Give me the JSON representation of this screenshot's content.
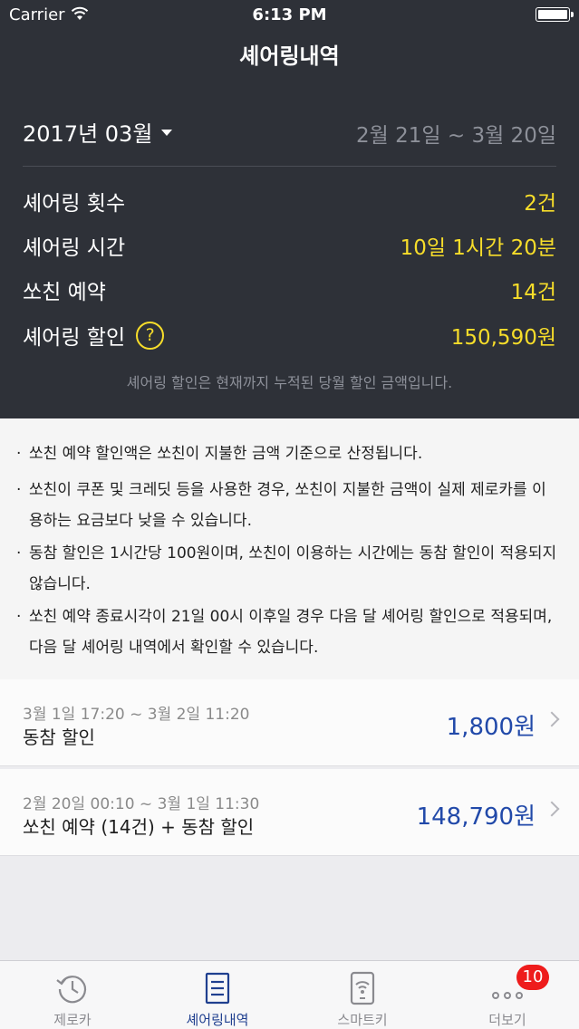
{
  "status_bar": {
    "carrier": "Carrier",
    "time": "6:13 PM"
  },
  "nav": {
    "title": "셰어링내역"
  },
  "period": {
    "month": "2017년 03월",
    "range": "2월 21일 ~ 3월 20일"
  },
  "stats": [
    {
      "label": "셰어링 횟수",
      "value": "2건"
    },
    {
      "label": "셰어링 시간",
      "value": "10일 1시간 20분"
    },
    {
      "label": "쏘친 예약",
      "value": "14건"
    },
    {
      "label": "셰어링 할인",
      "value": "150,590원",
      "help": "?"
    }
  ],
  "note": "셰어링 할인은 현재까지 누적된 당월 할인 금액입니다.",
  "info": [
    {
      "bullet": "·",
      "text": "쏘친 예약 할인액은 쏘친이 지불한 금액 기준으로 산정됩니다."
    },
    {
      "bullet": "·",
      "text": "쏘친이 쿠폰 및 크레딧 등을 사용한 경우, 쏘친이 지불한 금액이 실제 제로카를 이용하는 요금보다 낮을 수 있습니다."
    },
    {
      "bullet": "·",
      "text": "동참 할인은 1시간당 100원이며, 쏘친이 이용하는 시간에는 동참 할인이 적용되지 않습니다."
    },
    {
      "bullet": "·",
      "text": "쏘친 예약 종료시각이 21일 00시 이후일 경우 다음 달 셰어링 할인으로 적용되며, 다음 달 셰어링 내역에서 확인할 수 있습니다."
    }
  ],
  "records": [
    {
      "time": "3월 1일 17:20 ~ 3월 2일 11:20",
      "title": "동참 할인",
      "amount": "1,800원"
    },
    {
      "time": "2월 20일 00:10 ~ 3월 1일 11:30",
      "title": "쏘친 예약 (14건) + 동참 할인",
      "amount": "148,790원"
    }
  ],
  "tabs": [
    {
      "label": "제로카",
      "icon": "history-clock-icon"
    },
    {
      "label": "셰어링내역",
      "icon": "document-list-icon",
      "active": true
    },
    {
      "label": "스마트키",
      "icon": "smart-key-icon"
    },
    {
      "label": "더보기",
      "icon": "more-dots-icon",
      "badge": "10"
    }
  ],
  "colors": {
    "header_bg": "#2e3138",
    "highlight": "#f7dd2a",
    "amount": "#2149a9",
    "badge": "#ee1c1c"
  }
}
